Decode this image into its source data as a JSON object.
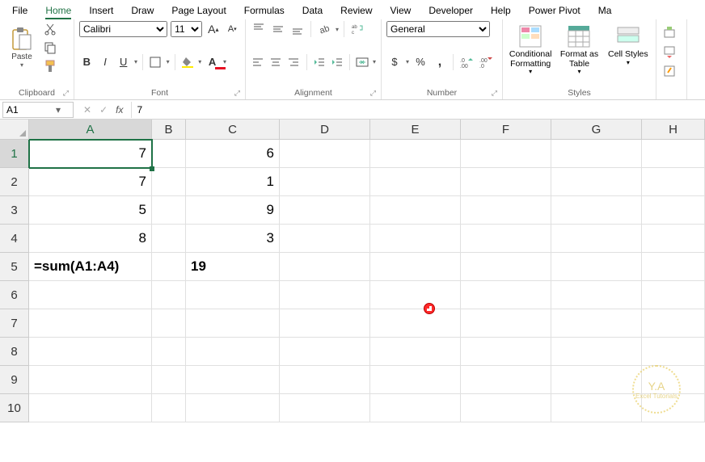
{
  "menu": {
    "items": [
      "File",
      "Home",
      "Insert",
      "Draw",
      "Page Layout",
      "Formulas",
      "Data",
      "Review",
      "View",
      "Developer",
      "Help",
      "Power Pivot",
      "Ma"
    ],
    "active": "Home"
  },
  "ribbon": {
    "clipboard": {
      "label": "Clipboard",
      "paste": "Paste"
    },
    "font": {
      "label": "Font",
      "name": "Calibri",
      "size": "11",
      "bold": "B",
      "italic": "I",
      "underline": "U"
    },
    "alignment": {
      "label": "Alignment"
    },
    "number": {
      "label": "Number",
      "format": "General",
      "currency": "$",
      "percent": "%",
      "comma": ","
    },
    "styles": {
      "label": "Styles",
      "cond": "Conditional Formatting",
      "table": "Format as Table",
      "cell": "Cell Styles"
    }
  },
  "formula": {
    "namebox": "A1",
    "value": "7",
    "cancel": "✕",
    "confirm": "✓",
    "fx": "fx"
  },
  "grid": {
    "cols": [
      "A",
      "B",
      "C",
      "D",
      "E",
      "F",
      "G",
      "H"
    ],
    "rows": [
      "1",
      "2",
      "3",
      "4",
      "5",
      "6",
      "7",
      "8",
      "9",
      "10"
    ],
    "selected_cell": "A1",
    "data": {
      "A1": "7",
      "A2": "7",
      "A3": "5",
      "A4": "8",
      "A5": "=sum(A1:A4)",
      "C1": "6",
      "C2": "1",
      "C3": "9",
      "C4": "3",
      "C5": "19"
    }
  },
  "watermark": {
    "main": "Y.A",
    "sub": "Excel Tutorials"
  }
}
